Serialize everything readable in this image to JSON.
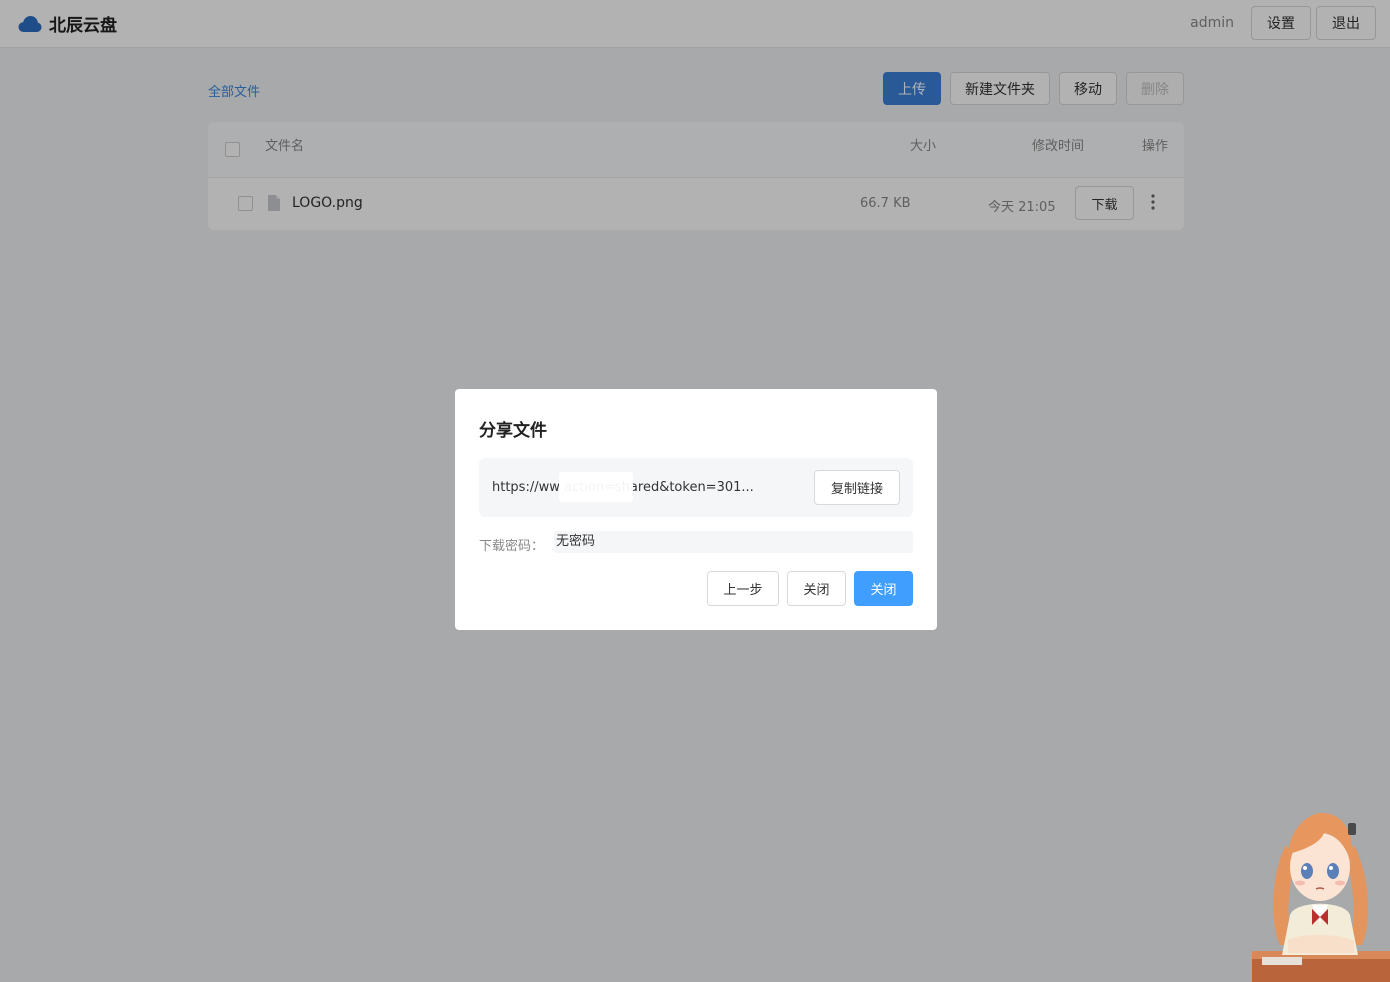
{
  "header": {
    "brand_title": "北辰云盘",
    "username": "admin",
    "settings_label": "设置",
    "logout_label": "退出"
  },
  "toolbar": {
    "breadcrumb": "全部文件",
    "upload_label": "上传",
    "new_folder_label": "新建文件夹",
    "move_label": "移动",
    "delete_label": "删除"
  },
  "table": {
    "columns": {
      "name": "文件名",
      "size": "大小",
      "modified": "修改时间",
      "actions": "操作"
    },
    "rows": [
      {
        "name": "LOGO.png",
        "size": "66.7 KB",
        "modified": "今天 21:05",
        "download_label": "下载"
      }
    ]
  },
  "share_dialog": {
    "title": "分享文件",
    "link": "https://ww                    action=shared&token=301...",
    "copy_label": "复制链接",
    "password_label": "下载密码：",
    "password_value": "无密码",
    "back_label": "上一步",
    "close_label": "关闭",
    "confirm_label": "关闭"
  },
  "colors": {
    "accent": "#409eff",
    "upload_button": "#3b82d8",
    "brand_icon": "#2b6fc4",
    "overlay": "rgba(0,0,0,0.30)"
  }
}
